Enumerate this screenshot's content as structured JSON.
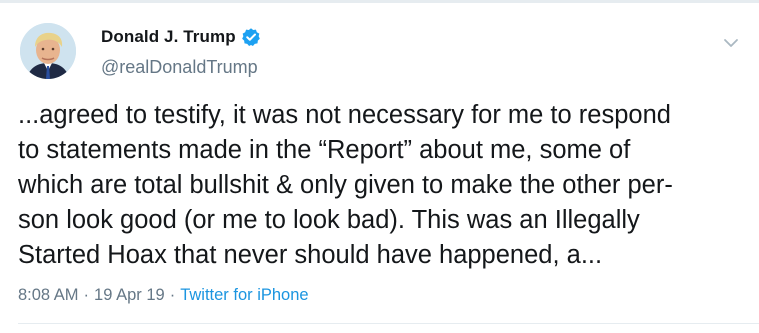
{
  "tweet": {
    "author": {
      "display_name": "Donald J. Trump",
      "handle": "@realDonaldTrump",
      "verified": true,
      "verified_icon": "verified-badge-icon",
      "avatar_icon": "profile-photo"
    },
    "text_lines": [
      "...agreed to testify, it was not necessary for me to respond",
      "to statements made in the “Report” about me, some of",
      "which are total bullshit & only given to make the other per-",
      "son look good (or me to look bad). This was an Illegally",
      "Started Hoax that never should have happened, a..."
    ],
    "time": "8:08 AM",
    "separator": "·",
    "date": "19 Apr 19",
    "source": "Twitter for iPhone",
    "menu_icon": "chevron-down-icon"
  },
  "colors": {
    "text": "#14171a",
    "secondary": "#657786",
    "link": "#1b95e0",
    "verified": "#1da1f2",
    "divider": "#e6ecf0"
  }
}
